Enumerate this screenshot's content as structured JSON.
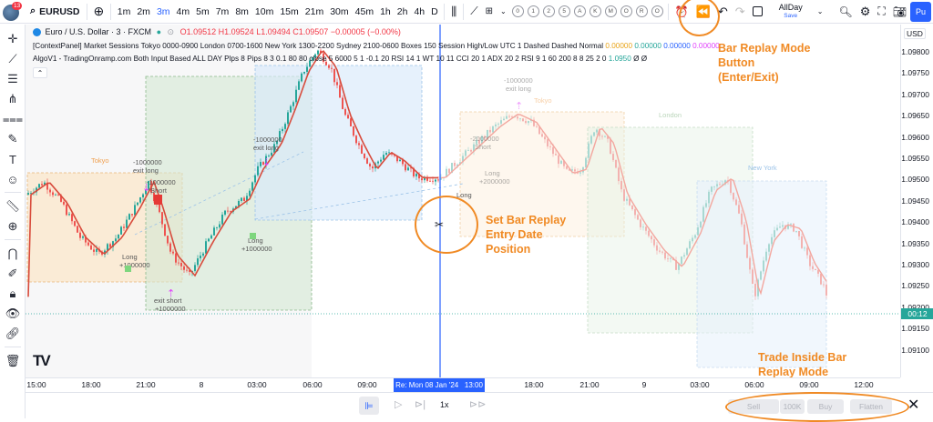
{
  "toolbar": {
    "badge": "13",
    "symbol": "EURUSD",
    "intervals": [
      "1m",
      "2m",
      "3m",
      "4m",
      "5m",
      "7m",
      "8m",
      "10m",
      "15m",
      "21m",
      "30m",
      "45m",
      "1h",
      "2h",
      "4h",
      "D"
    ],
    "active_interval": "3m",
    "circles": [
      "0",
      "1",
      "2",
      "5",
      "A",
      "K",
      "M",
      "O",
      "R",
      "O"
    ],
    "allday": "AllDay",
    "save": "Save",
    "publish": "Pu"
  },
  "legend": {
    "symbol_title": "Euro / U.S. Dollar · 3 · FXCM",
    "o": "O1.09512",
    "h": "H1.09524",
    "l": "L1.09494",
    "c": "C1.09507",
    "chg": "−0.00005 (−0.00%)",
    "indicator1": "[ContextPanel] Market Sessions Tokyo 0000-0900 London 0700-1600 New York 1300-2200 Sydney 2100-0600 Boxes 150 Session High/Low UTC 1 Dashed Dashed Normal",
    "indicator1_vals": [
      "0.00000",
      "0.00000",
      "0.00000",
      "0.00000"
    ],
    "indicator2": "AlgoV1 - TradingOnramp.com Both Input Based ALL DAY Plps 8 Pips 8 3 0.1 80 80 close 5 6000 5 1 -0.1 20 RSI 14 1 WT 10 11 CCI 20 1 ADX 20 2 RSI 9 1 60 200 8 8 25 2 0",
    "indicator2_val": "1.0950",
    "indicator2_tail": "Ø Ø"
  },
  "chart_labels": {
    "tokyo": "Tokyo",
    "tokyo2": "Tokyo",
    "london": "London",
    "newyork": "New York",
    "exit_long1_val": "-1000000",
    "exit_long1": "exit long",
    "short1_val": "-1000000",
    "short1": "Short",
    "long1": "Long",
    "long1_val": "+1000000",
    "exit_short": "exit short",
    "exit_short_val": "+1000000",
    "exit_long2_val": "-1000000",
    "exit_long2": "exit long",
    "long2": "Long",
    "long2_val": "+1000000",
    "long3": "Long",
    "exit_long3_val": "-1000000",
    "exit_long3": "exit long",
    "short3_val": "-2000000",
    "short3": "Short",
    "long4": "Long",
    "long4_val": "+2000000"
  },
  "yaxis": {
    "currency": "USD",
    "ticks": [
      "1.09800",
      "1.09750",
      "1.09700",
      "1.09650",
      "1.09600",
      "1.09550",
      "1.09500",
      "1.09450",
      "1.09400",
      "1.09350",
      "1.09300",
      "1.09250",
      "1.09200",
      "1.09150",
      "1.09100"
    ],
    "countdown": "00:12"
  },
  "xaxis": {
    "ticks": [
      "15:00",
      "18:00",
      "21:00",
      "8",
      "03:00",
      "06:00",
      "09:00",
      "18:00",
      "21:00",
      "9",
      "03:00",
      "06:00",
      "09:00",
      "12:00"
    ],
    "replay_label": "Re: Mon 08 Jan '24   13:00"
  },
  "bottombar": {
    "speed": "1x",
    "sell": "Sell",
    "qty": "100K",
    "buy": "Buy",
    "flatten": "Flatten"
  },
  "annotations": {
    "replay_button": "Bar Replay Mode\nButton\n(Enter/Exit)",
    "entry_date": "Set Bar Replay\nEntry Date\nPosition",
    "trade_inside": "Trade Inside Bar\nReplay Mode"
  },
  "colors": {
    "accent": "#2962ff",
    "annotation": "#f08a24",
    "bull": "#26a69a",
    "bear": "#ef5350",
    "ma": "#d84b3c"
  }
}
